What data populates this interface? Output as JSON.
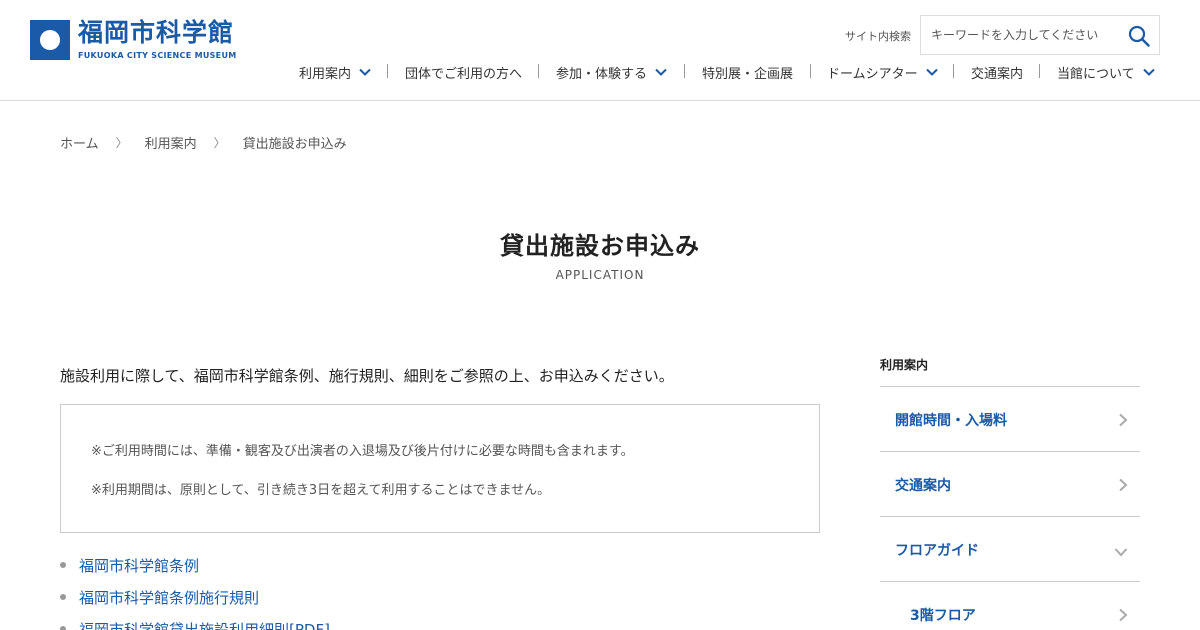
{
  "header": {
    "logo_name": "福岡市科学館",
    "logo_sub": "FUKUOKA CITY SCIENCE MUSEUM",
    "search_label": "サイト内検索",
    "search_placeholder": "キーワードを入力してください",
    "nav": [
      {
        "label": "利用案内",
        "dropdown": true
      },
      {
        "label": "団体でご利用の方へ",
        "dropdown": false
      },
      {
        "label": "参加・体験する",
        "dropdown": true
      },
      {
        "label": "特別展・企画展",
        "dropdown": false
      },
      {
        "label": "ドームシアター",
        "dropdown": true
      },
      {
        "label": "交通案内",
        "dropdown": false
      },
      {
        "label": "当館について",
        "dropdown": true
      }
    ]
  },
  "breadcrumb": {
    "items": [
      "ホーム",
      "利用案内",
      "貸出施設お申込み"
    ],
    "separator": "〉"
  },
  "page": {
    "title": "貸出施設お申込み",
    "subtitle": "APPLICATION"
  },
  "main": {
    "intro": "施設利用に際して、福岡市科学館条例、施行規則、細則をご参照の上、お申込みください。",
    "notices": [
      "※ご利用時間には、準備・観客及び出演者の入退場及び後片付けに必要な時間も含まれます。",
      "※利用期間は、原則として、引き続き3日を超えて利用することはできません。"
    ],
    "links": [
      "福岡市科学館条例",
      "福岡市科学館条例施行規則",
      "福岡市科学館貸出施設利用細則[PDF]"
    ]
  },
  "side_nav": {
    "heading": "利用案内",
    "items": [
      {
        "label": "開館時間・入場料",
        "arrow": "right",
        "sub": false
      },
      {
        "label": "交通案内",
        "arrow": "right",
        "sub": false
      },
      {
        "label": "フロアガイド",
        "arrow": "down",
        "sub": false
      },
      {
        "label": "3階フロア",
        "arrow": "right",
        "sub": true
      }
    ]
  },
  "colors": {
    "brand": "#1a5aa6",
    "text": "#333333",
    "border": "#cccccc"
  }
}
